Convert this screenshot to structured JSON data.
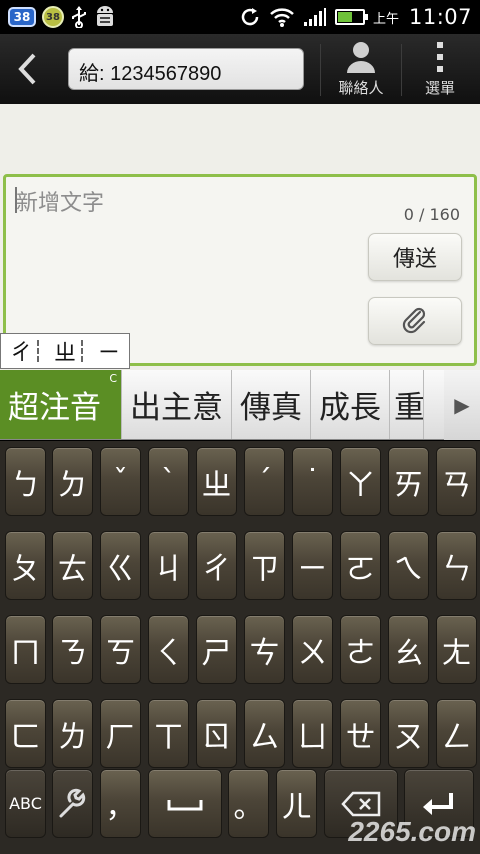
{
  "status_bar": {
    "badge_38": "38",
    "badge_green": "38",
    "ampm": "上午",
    "time": "11:07",
    "battery_level": 0.6,
    "icons": [
      "usb-icon",
      "android-debug-icon",
      "sync-icon",
      "wifi-icon",
      "signal-icon",
      "battery-charging-icon"
    ]
  },
  "title_bar": {
    "to_field_value": "給: 1234567890",
    "contacts_label": "聯絡人",
    "menu_label": "選單"
  },
  "composer": {
    "placeholder": "新增文字",
    "char_counter": "0 / 160",
    "send_label": "傳送"
  },
  "preedit": {
    "syllables": [
      "ㄔ",
      "ㄓ",
      "ㄧ"
    ]
  },
  "candidates": {
    "mode_label": "超注音",
    "mode_tag": "C",
    "items": [
      "出主意",
      "傳真",
      "成長",
      "重"
    ]
  },
  "keyboard": {
    "rows": [
      [
        "ㄅ",
        "ㄉ",
        "ˇ",
        "ˋ",
        "ㄓ",
        "ˊ",
        "˙",
        "ㄚ",
        "ㄞ",
        "ㄢ"
      ],
      [
        "ㄆ",
        "ㄊ",
        "ㄍ",
        "ㄐ",
        "ㄔ",
        "ㄗ",
        "ㄧ",
        "ㄛ",
        "ㄟ",
        "ㄣ"
      ],
      [
        "ㄇ",
        "ㄋ",
        "ㄎ",
        "ㄑ",
        "ㄕ",
        "ㄘ",
        "ㄨ",
        "ㄜ",
        "ㄠ",
        "ㄤ"
      ],
      [
        "ㄈ",
        "ㄌ",
        "ㄏ",
        "ㄒ",
        "ㄖ",
        "ㄙ",
        "ㄩ",
        "ㄝ",
        "ㄡ",
        "ㄥ"
      ]
    ],
    "bottom": {
      "abc_label": "ABC",
      "comma_label": "，",
      "period_label": "。",
      "er_label": "ㄦ"
    }
  },
  "watermark": "2265.com"
}
